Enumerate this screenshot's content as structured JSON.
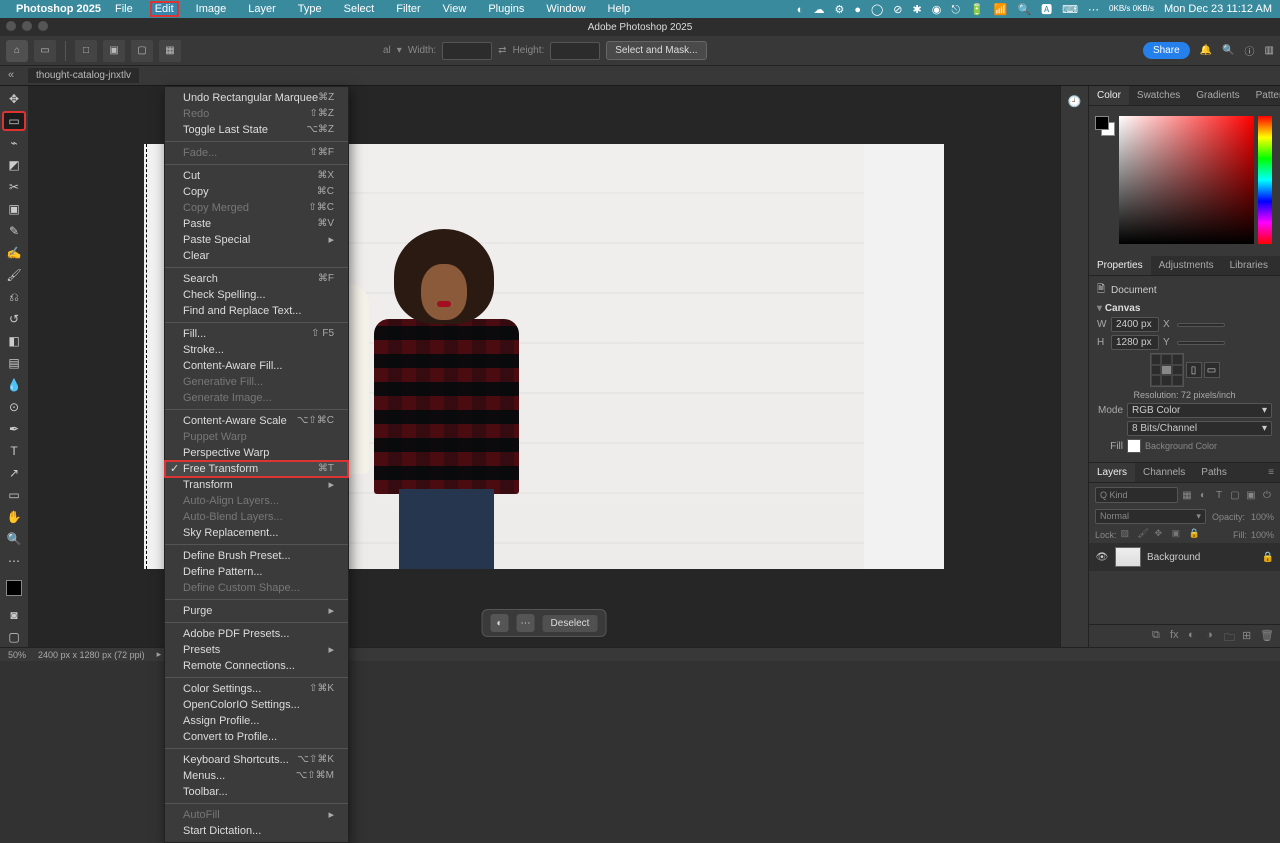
{
  "mac": {
    "app": "Photoshop 2025",
    "menus": [
      "File",
      "Edit",
      "Image",
      "Layer",
      "Type",
      "Select",
      "Filter",
      "View",
      "Plugins",
      "Window",
      "Help"
    ],
    "active_menu_index": 1,
    "status_icons": [
      "◐",
      "☁",
      "⚙",
      "●",
      "◯",
      "⊘",
      "✱",
      "◉",
      "⎋",
      "🔋",
      "📶",
      "🔍",
      "🅰",
      "⌨",
      "⋯"
    ],
    "net": "0KB/s 0KB/s",
    "clock": "Mon Dec 23  11:12 AM"
  },
  "app_title": "Adobe Photoshop 2025",
  "options": {
    "style_label": "al",
    "width_label": "Width:",
    "height_label": "Height:",
    "select_mask": "Select and Mask...",
    "share": "Share"
  },
  "doc_tab": "thought-catalog-jnxtlv",
  "edit_menu": [
    {
      "t": "Undo Rectangular Marquee",
      "s": "⌘Z"
    },
    {
      "t": "Redo",
      "s": "⇧⌘Z",
      "d": true
    },
    {
      "t": "Toggle Last State",
      "s": "⌥⌘Z"
    },
    "-",
    {
      "t": "Fade...",
      "s": "⇧⌘F",
      "d": true
    },
    "-",
    {
      "t": "Cut",
      "s": "⌘X"
    },
    {
      "t": "Copy",
      "s": "⌘C"
    },
    {
      "t": "Copy Merged",
      "s": "⇧⌘C",
      "d": true
    },
    {
      "t": "Paste",
      "s": "⌘V"
    },
    {
      "t": "Paste Special",
      "sub": true
    },
    {
      "t": "Clear"
    },
    "-",
    {
      "t": "Search",
      "s": "⌘F"
    },
    {
      "t": "Check Spelling..."
    },
    {
      "t": "Find and Replace Text..."
    },
    "-",
    {
      "t": "Fill...",
      "s": "⇧ F5"
    },
    {
      "t": "Stroke..."
    },
    {
      "t": "Content-Aware Fill..."
    },
    {
      "t": "Generative Fill...",
      "d": true
    },
    {
      "t": "Generate Image...",
      "d": true
    },
    "-",
    {
      "t": "Content-Aware Scale",
      "s": "⌥⇧⌘C"
    },
    {
      "t": "Puppet Warp",
      "d": true
    },
    {
      "t": "Perspective Warp"
    },
    {
      "t": "Free Transform",
      "s": "⌘T",
      "hl": true,
      "ck": true
    },
    {
      "t": "Transform",
      "sub": true
    },
    {
      "t": "Auto-Align Layers...",
      "d": true
    },
    {
      "t": "Auto-Blend Layers...",
      "d": true
    },
    {
      "t": "Sky Replacement..."
    },
    "-",
    {
      "t": "Define Brush Preset..."
    },
    {
      "t": "Define Pattern..."
    },
    {
      "t": "Define Custom Shape...",
      "d": true
    },
    "-",
    {
      "t": "Purge",
      "sub": true
    },
    "-",
    {
      "t": "Adobe PDF Presets..."
    },
    {
      "t": "Presets",
      "sub": true
    },
    {
      "t": "Remote Connections..."
    },
    "-",
    {
      "t": "Color Settings...",
      "s": "⇧⌘K"
    },
    {
      "t": "OpenColorIO Settings..."
    },
    {
      "t": "Assign Profile..."
    },
    {
      "t": "Convert to Profile..."
    },
    "-",
    {
      "t": "Keyboard Shortcuts...",
      "s": "⌥⇧⌘K"
    },
    {
      "t": "Menus...",
      "s": "⌥⇧⌘M"
    },
    {
      "t": "Toolbar..."
    },
    "-",
    {
      "t": "AutoFill",
      "d": true,
      "sub": true
    },
    {
      "t": "Start Dictation..."
    }
  ],
  "context_bar": {
    "deselect": "Deselect"
  },
  "right": {
    "color_tabs": [
      "Color",
      "Swatches",
      "Gradients",
      "Patterns"
    ],
    "props_tabs": [
      "Properties",
      "Adjustments",
      "Libraries"
    ],
    "document_label": "Document",
    "canvas_label": "Canvas",
    "w_label": "W",
    "h_label": "H",
    "x_label": "X",
    "y_label": "Y",
    "w_val": "2400 px",
    "h_val": "1280 px",
    "resolution_label": "Resolution: 72 pixels/inch",
    "mode_label": "Mode",
    "mode_val": "RGB Color",
    "depth_val": "8 Bits/Channel",
    "fill_label": "Fill",
    "fill_val": "Background Color",
    "layers_tabs": [
      "Layers",
      "Channels",
      "Paths"
    ],
    "kind_label": "Q Kind",
    "blend_mode": "Normal",
    "opacity_label": "Opacity:",
    "opacity_val": "100%",
    "lock_label": "Lock:",
    "fill_opacity_label": "Fill:",
    "fill_opacity_val": "100%",
    "layer_name": "Background"
  },
  "status": {
    "zoom": "50%",
    "dims": "2400 px x 1280 px (72 ppi)"
  }
}
